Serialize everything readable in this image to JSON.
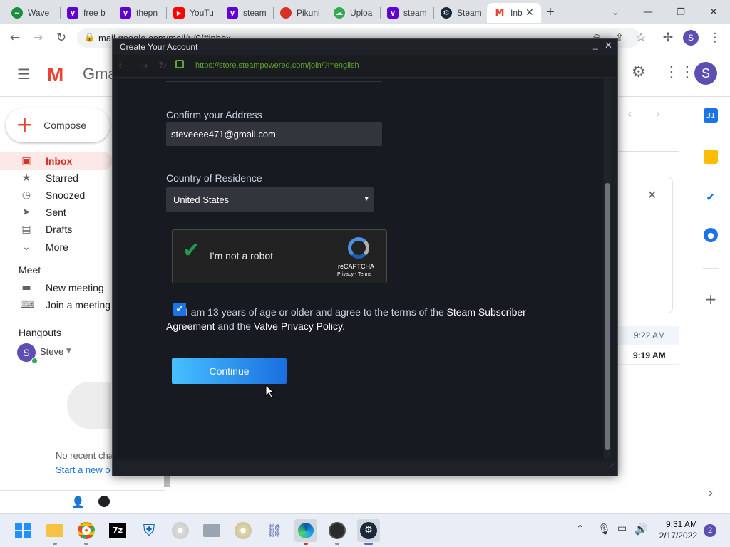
{
  "browser": {
    "tabs": [
      {
        "label": "Wave",
        "icon": "wave-favicon-icon",
        "color": "#1e8e3e"
      },
      {
        "label": "free b",
        "icon": "yahoo-favicon-icon",
        "color": "#6001d2"
      },
      {
        "label": "thepn",
        "icon": "yahoo-favicon-icon",
        "color": "#6001d2"
      },
      {
        "label": "YouTu",
        "icon": "youtube-favicon-icon",
        "color": "#ff0000"
      },
      {
        "label": "steam",
        "icon": "yahoo-favicon-icon",
        "color": "#6001d2"
      },
      {
        "label": "Pikuni",
        "icon": "pikuni-favicon-icon",
        "color": "#d93025"
      },
      {
        "label": "Uploa",
        "icon": "upload-cloud-favicon-icon",
        "color": "#34a853"
      },
      {
        "label": "steam",
        "icon": "yahoo-favicon-icon",
        "color": "#6001d2"
      },
      {
        "label": "Steam",
        "icon": "steam-favicon-icon",
        "color": "#1b2838"
      },
      {
        "label": "Inb",
        "icon": "gmail-favicon-icon",
        "color": "#ea4335"
      }
    ],
    "new_tab": "+",
    "url": "mail.google.com/mail/u/0/#inbox",
    "profile_initial": "S"
  },
  "gmail": {
    "logo_text": "Gma",
    "compose_label": "Compose",
    "nav": [
      {
        "label": "Inbox",
        "icon": "inbox-icon"
      },
      {
        "label": "Starred",
        "icon": "star-icon"
      },
      {
        "label": "Snoozed",
        "icon": "clock-icon"
      },
      {
        "label": "Sent",
        "icon": "send-icon"
      },
      {
        "label": "Drafts",
        "icon": "draft-icon"
      },
      {
        "label": "More",
        "icon": "chevron-down-icon"
      }
    ],
    "meet_heading": "Meet",
    "meet_items": [
      {
        "label": "New meeting",
        "icon": "video-icon"
      },
      {
        "label": "Join a meeting",
        "icon": "keyboard-icon"
      }
    ],
    "hangouts_heading": "Hangouts",
    "hangouts_user": "Steve",
    "hangouts_initial": "S",
    "no_chats_text": "No recent cha",
    "start_new_link": "Start a new o",
    "email_times": [
      "9:22 AM",
      "9:19 AM"
    ],
    "profile_initial": "S"
  },
  "steam": {
    "window_title": "Create Your Account",
    "url": "https://store.steampowered.com/join/?l=english",
    "confirm_address_label": "Confirm your Address",
    "confirm_address_value": "steveeee471@gmail.com",
    "country_label": "Country of Residence",
    "country_value": "United States",
    "captcha": {
      "label": "I'm not a robot",
      "brand": "reCAPTCHA",
      "links": "Privacy - Terms",
      "checked": true
    },
    "agreement": {
      "checked": true,
      "text_1": "I am 13 years of age or older and agree to the terms of the ",
      "link_1": "Steam Subscriber Agreement",
      "text_2": " and the ",
      "link_2": "Valve Privacy Policy",
      "text_3": "."
    },
    "continue_label": "Continue"
  },
  "taskbar": {
    "time": "9:31 AM",
    "date": "2/17/2022",
    "notification_count": "2"
  }
}
